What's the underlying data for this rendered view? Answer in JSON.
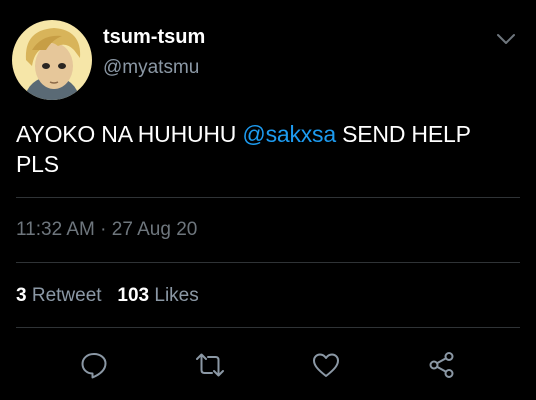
{
  "user": {
    "display_name": "tsum-tsum",
    "handle": "@myatsmu"
  },
  "tweet": {
    "text_before": "AYOKO NA HUHUHU ",
    "mention": "@sakxsa",
    "text_after": " SEND HELP PLS",
    "timestamp": "11:32 AM · 27 Aug 20"
  },
  "stats": {
    "retweet_count": "3",
    "retweet_label": "Retweet",
    "likes_count": "103",
    "likes_label": "Likes"
  },
  "icons": {
    "more": "chevron-down-icon",
    "reply": "reply-icon",
    "retweet": "retweet-icon",
    "like": "heart-icon",
    "share": "share-icon"
  },
  "colors": {
    "background": "#000000",
    "primary_text": "#ffffff",
    "secondary_text": "#8b98a5",
    "mention": "#1d9bf0",
    "divider": "#2f3336"
  }
}
